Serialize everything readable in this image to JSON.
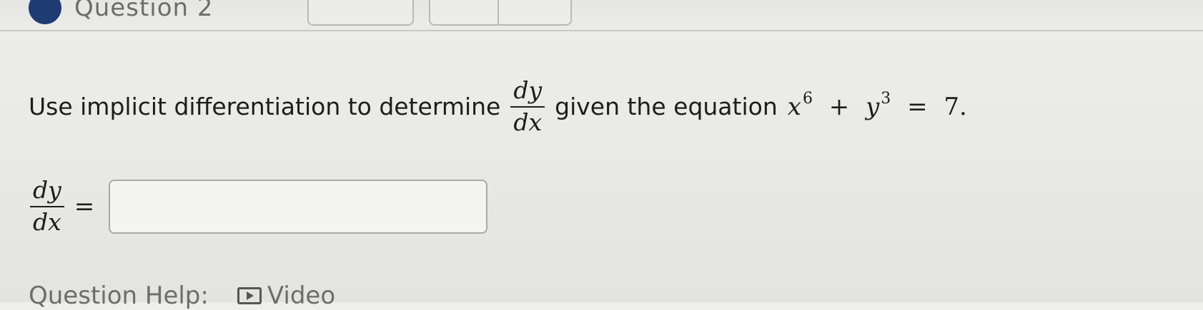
{
  "header": {
    "question_title": "Question 2"
  },
  "problem": {
    "text_before": "Use implicit differentiation to determine",
    "derivative": {
      "numerator": "dy",
      "denominator": "dx"
    },
    "text_after": "given the equation",
    "equation": {
      "term1_base": "x",
      "term1_exp": "6",
      "plus": "+",
      "term2_base": "y",
      "term2_exp": "3",
      "equals": "=",
      "rhs": "7."
    }
  },
  "answer": {
    "lhs": {
      "numerator": "dy",
      "denominator": "dx"
    },
    "equals": "=",
    "value": "",
    "placeholder": ""
  },
  "help": {
    "label": "Question Help:",
    "video_label": "Video"
  },
  "colors": {
    "status_dot": "#1f3b73",
    "background": "#eaeae8"
  }
}
